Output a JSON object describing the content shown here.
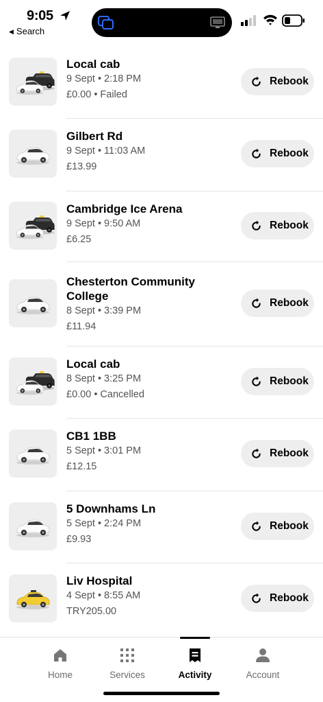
{
  "status": {
    "time": "9:05",
    "back_label": "Search"
  },
  "rides": [
    {
      "title": "Local cab",
      "datetime": "9 Sept • 2:18 PM",
      "detail": "£0.00 • Failed",
      "vehicle": "black-cab-and-car",
      "rebook_label": "Rebook"
    },
    {
      "title": "Gilbert Rd",
      "datetime": "9 Sept • 11:03 AM",
      "detail": "£13.99",
      "vehicle": "white-car",
      "rebook_label": "Rebook"
    },
    {
      "title": "Cambridge Ice Arena",
      "datetime": "9 Sept • 9:50 AM",
      "detail": "£6.25",
      "vehicle": "black-cab-and-car",
      "rebook_label": "Rebook"
    },
    {
      "title": "Chesterton Community College",
      "datetime": "8 Sept • 3:39 PM",
      "detail": "£11.94",
      "vehicle": "white-car",
      "rebook_label": "Rebook"
    },
    {
      "title": "Local cab",
      "datetime": "8 Sept • 3:25 PM",
      "detail": "£0.00 • Cancelled",
      "vehicle": "black-cab-and-car",
      "rebook_label": "Rebook"
    },
    {
      "title": "CB1 1BB",
      "datetime": "5 Sept • 3:01 PM",
      "detail": "£12.15",
      "vehicle": "white-car",
      "rebook_label": "Rebook"
    },
    {
      "title": "5 Downhams Ln",
      "datetime": "5 Sept • 2:24 PM",
      "detail": "£9.93",
      "vehicle": "white-car",
      "rebook_label": "Rebook"
    },
    {
      "title": "Liv Hospital",
      "datetime": "4 Sept • 8:55 AM",
      "detail": "TRY205.00",
      "vehicle": "yellow-taxi",
      "rebook_label": "Rebook"
    }
  ],
  "tabs": [
    {
      "label": "Home",
      "icon": "home-icon",
      "active": false
    },
    {
      "label": "Services",
      "icon": "grid-icon",
      "active": false
    },
    {
      "label": "Activity",
      "icon": "receipt-icon",
      "active": true
    },
    {
      "label": "Account",
      "icon": "person-icon",
      "active": false
    }
  ],
  "colors": {
    "button_bg": "#eeeeee",
    "thumb_bg": "#eeeeee",
    "secondary_text": "#545454",
    "taxi_yellow": "#f2cc33"
  }
}
